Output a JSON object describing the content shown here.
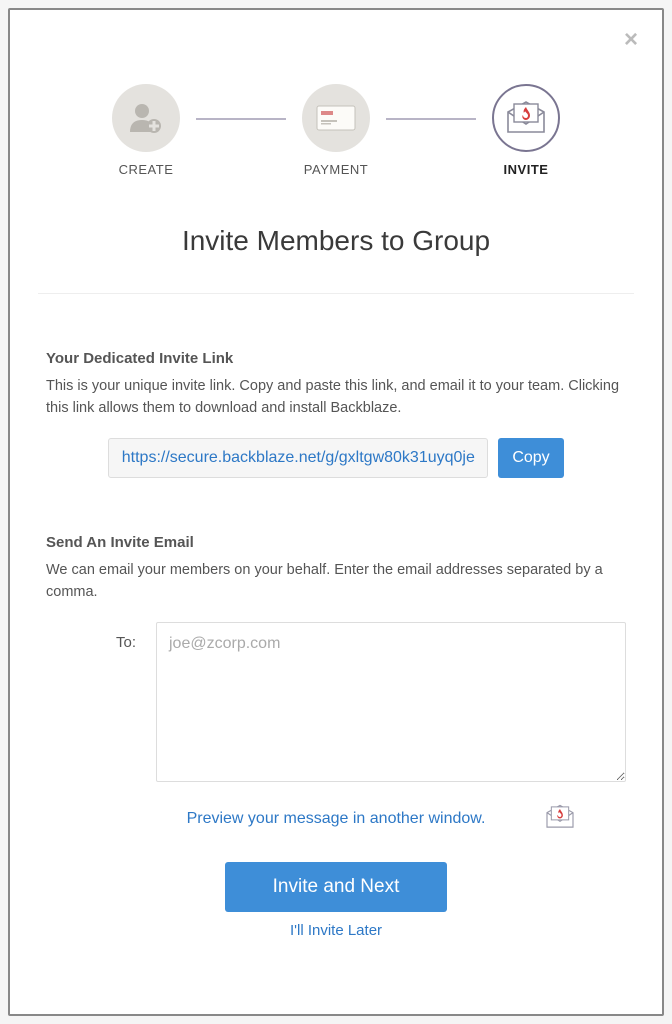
{
  "steps": {
    "create": "CREATE",
    "payment": "PAYMENT",
    "invite": "INVITE"
  },
  "title": "Invite Members to Group",
  "inviteLink": {
    "heading": "Your Dedicated Invite Link",
    "desc": "This is your unique invite link. Copy and paste this link, and email it to your team. Clicking this link allows them to download and install Backblaze.",
    "url": "https://secure.backblaze.net/g/gxltgw80k31uyq0je",
    "copyLabel": "Copy"
  },
  "emailSection": {
    "heading": "Send An Invite Email",
    "desc": "We can email your members on your behalf. Enter the email addresses separated by a comma.",
    "toLabel": "To:",
    "placeholder": "joe@zcorp.com"
  },
  "previewLink": "Preview your message in another window.",
  "actions": {
    "inviteNext": "Invite and Next",
    "later": "I'll Invite Later"
  }
}
